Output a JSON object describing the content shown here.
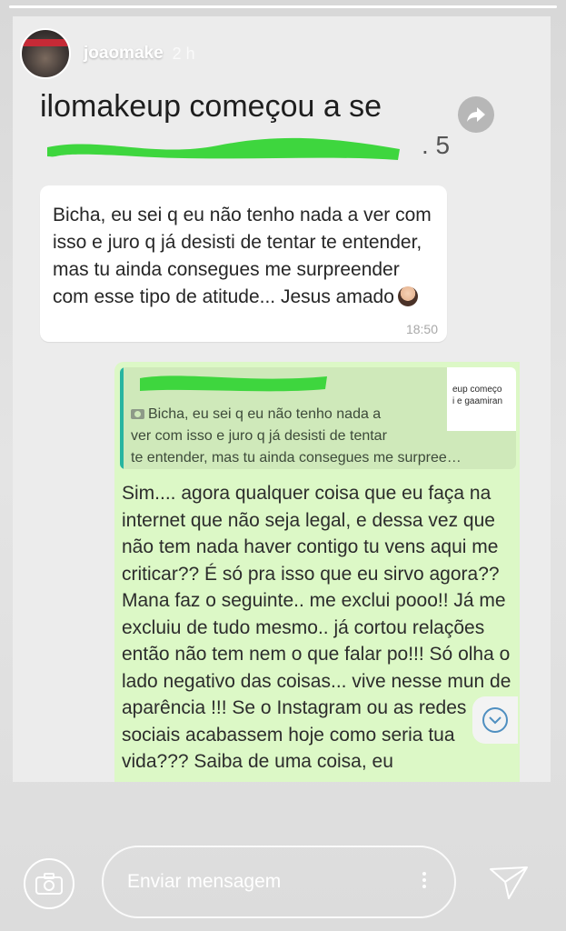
{
  "story": {
    "username": "joaomake",
    "time_ago": "2 h",
    "progress_percent": 100
  },
  "quoted_header": {
    "title": "ilomakeup começou a se",
    "trailing_num": ". 5"
  },
  "incoming_message": {
    "text": "Bicha, eu sei q eu não tenho nada a ver com isso e juro q já desisti de tentar te entender, mas tu ainda consegues me surpreender com esse tipo de atitude... Jesus amado",
    "emoji_icon": "woman-facepalm-emoji",
    "time": "18:50"
  },
  "reply_preview": {
    "thumb_line_1": "eup começo",
    "thumb_line_2": "i e gaamiran",
    "line_1": "Bicha, eu sei q eu não tenho nada a",
    "line_2": "ver com isso e juro q já desisti de tentar",
    "line_3": "te entender, mas tu ainda consegues me surpree…"
  },
  "outgoing_message": {
    "text": "Sim.... agora qualquer coisa que eu faça na internet que não seja legal, e dessa vez que não tem nada haver contigo tu vens aqui me criticar?? É só pra isso que eu sirvo agora?? Mana faz o seguinte.. me exclui pooo!! Já me excluiu de tudo mesmo.. já cortou relações então não tem nem o que falar po!!! Só olha o lado negativo das coisas... vive nesse mun de aparência !!! Se o Instagram ou as redes sociais acabassem hoje como seria tua vida??? Saiba de uma coisa, eu"
  },
  "composer": {
    "placeholder": "Enviar mensagem"
  },
  "colors": {
    "incoming_bubble": "#ffffff",
    "outgoing_bubble": "#dcf8c6",
    "reply_accent": "#27b5a0",
    "scribble": "#3ed63e"
  }
}
